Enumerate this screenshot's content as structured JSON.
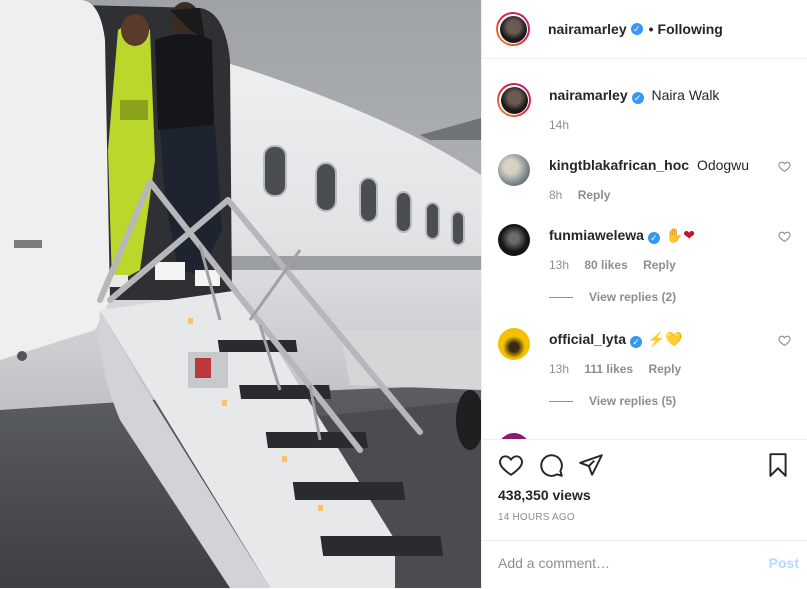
{
  "header": {
    "username": "nairamarley",
    "separator": "•",
    "follow_status": "Following"
  },
  "caption": {
    "username": "nairamarley",
    "text": "Naira Walk",
    "time": "14h"
  },
  "comments": [
    {
      "username": "kingtblakafrican_hoc",
      "verified": false,
      "text": "Odogwu",
      "time": "8h",
      "likes": "",
      "reply": "Reply",
      "replies": ""
    },
    {
      "username": "funmiawelewa",
      "verified": true,
      "text": "✋❤",
      "time": "13h",
      "likes": "80 likes",
      "reply": "Reply",
      "replies": "View replies (2)"
    },
    {
      "username": "official_lyta",
      "verified": true,
      "text": "⚡💛",
      "time": "13h",
      "likes": "111 likes",
      "reply": "Reply",
      "replies": "View replies (5)"
    }
  ],
  "stats": {
    "views": "438,350 views",
    "posted": "14 HOURS AGO"
  },
  "add_comment": {
    "placeholder": "Add a comment…",
    "post_label": "Post"
  },
  "icons": {
    "like": "heart-icon",
    "comment": "comment-icon",
    "share": "share-icon",
    "save": "bookmark-icon",
    "verified": "verified-badge-icon"
  },
  "colors": {
    "verified": "#3897f0",
    "post_disabled": "#b3dbff",
    "muted_text": "#8e8e8e"
  }
}
